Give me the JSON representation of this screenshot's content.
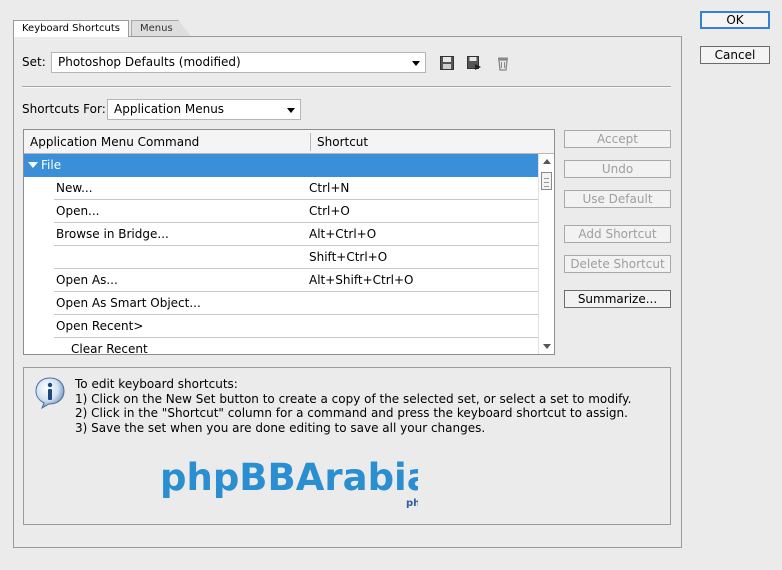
{
  "tabs": [
    {
      "label": "Keyboard Shortcuts",
      "active": true
    },
    {
      "label": "Menus",
      "active": false
    }
  ],
  "set": {
    "label": "Set:",
    "value": "Photoshop Defaults (modified)",
    "icons": [
      "save-icon",
      "save-as-icon",
      "delete-icon"
    ]
  },
  "shortcuts_for": {
    "label": "Shortcuts For:",
    "value": "Application Menus"
  },
  "table": {
    "col_command": "Application Menu Command",
    "col_shortcut": "Shortcut",
    "group": "File",
    "rows": [
      {
        "command": "New...",
        "shortcut": "Ctrl+N"
      },
      {
        "command": "Open...",
        "shortcut": "Ctrl+O"
      },
      {
        "command": "Browse in Bridge...",
        "shortcut": "Alt+Ctrl+O"
      },
      {
        "command": "",
        "shortcut": "Shift+Ctrl+O"
      },
      {
        "command": "Open As...",
        "shortcut": "Alt+Shift+Ctrl+O"
      },
      {
        "command": "Open As Smart Object...",
        "shortcut": ""
      },
      {
        "command": "Open Recent>",
        "shortcut": ""
      },
      {
        "command": "Clear Recent",
        "shortcut": ""
      }
    ]
  },
  "side_buttons": {
    "accept": "Accept",
    "undo": "Undo",
    "use_default": "Use Default",
    "add_shortcut": "Add Shortcut",
    "delete_shortcut": "Delete Shortcut",
    "summarize": "Summarize..."
  },
  "info": {
    "heading": "To edit keyboard shortcuts:",
    "step1": "1) Click on the New Set button to create a copy of the selected set, or select a set to modify.",
    "step2": "2) Click in the \"Shortcut\" column for a command and press the keyboard shortcut to assign.",
    "step3": "3) Save the set when you are done editing to save all your changes."
  },
  "watermark": {
    "logo_text": "phpBBArabia",
    "tagline": "الدعم العربي لمنتديات phpBB"
  },
  "dialog_buttons": {
    "ok": "OK",
    "cancel": "Cancel"
  },
  "colors": {
    "selection": "#3b8fd9",
    "logo_blue": "#2a8fd0"
  }
}
